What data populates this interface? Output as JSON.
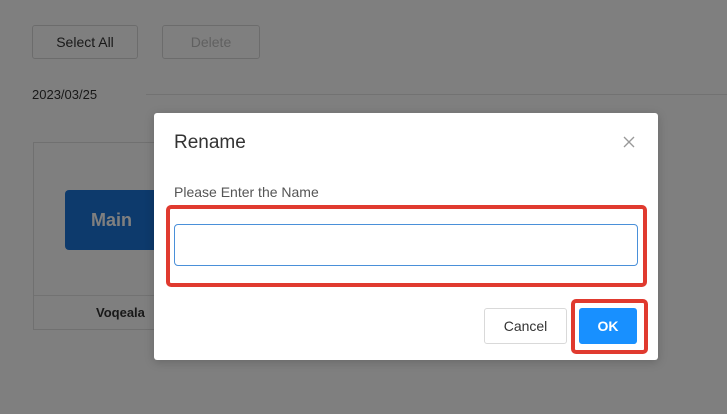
{
  "toolbar": {
    "select_all_label": "Select All",
    "delete_label": "Delete"
  },
  "section": {
    "date": "2023/03/25"
  },
  "card": {
    "thumb_label": "Main",
    "name": "Voqeala"
  },
  "dialog": {
    "title": "Rename",
    "field_label": "Please Enter the Name",
    "input_value": "",
    "cancel_label": "Cancel",
    "ok_label": "OK",
    "close_icon": "close-icon"
  },
  "colors": {
    "primary": "#1890ff",
    "thumb": "#1a74d9",
    "highlight": "#e03a2f",
    "input_focus_border": "#4a90d9"
  }
}
